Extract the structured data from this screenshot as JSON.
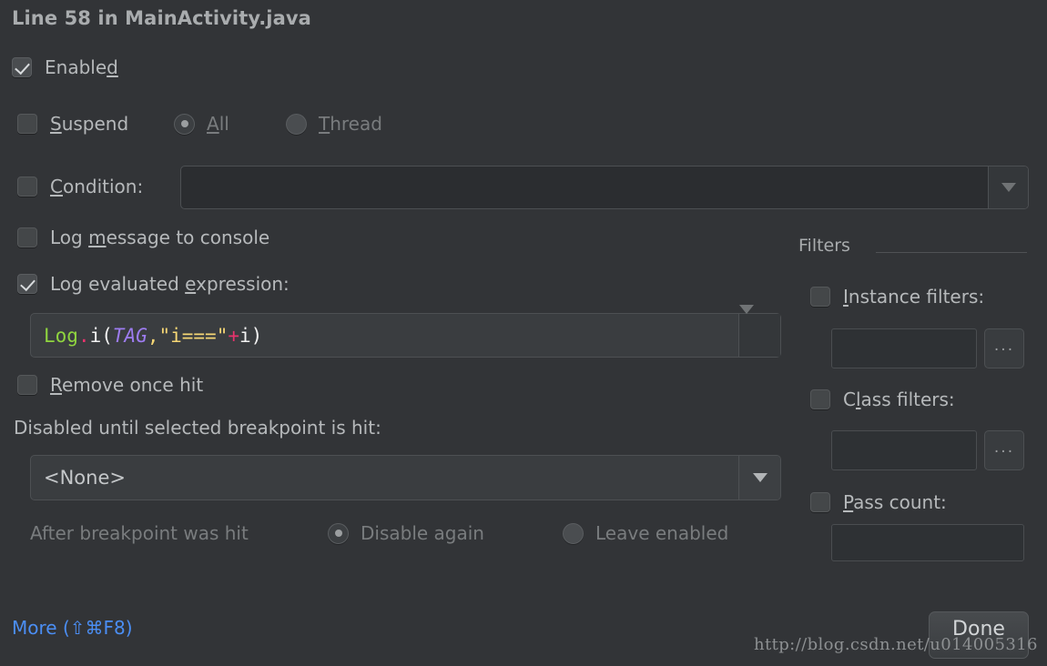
{
  "dialog": {
    "title": "Line 58 in MainActivity.java"
  },
  "enabled_row": {
    "label_pre": "Enable",
    "label_mnemonic": "d",
    "checked": true
  },
  "suspend_row": {
    "label_mnemonic": "S",
    "label_post": "uspend",
    "checked": false,
    "options": [
      {
        "label_mnemonic": "A",
        "label_post": "ll",
        "selected": true
      },
      {
        "label_mnemonic": "T",
        "label_post": "hread",
        "selected": false
      }
    ]
  },
  "condition_row": {
    "label_mnemonic": "C",
    "label_post": "ondition:",
    "checked": false,
    "value": "",
    "arrow_icon": "chevron-down-icon"
  },
  "log_message_row": {
    "label_pre": "Log ",
    "label_mnemonic": "m",
    "label_post": "essage to console",
    "checked": false
  },
  "log_expression_row": {
    "label_pre": "Log evaluated ",
    "label_mnemonic": "e",
    "label_post": "xpression:",
    "checked": true,
    "arrow_icon": "chevron-down-icon",
    "expression": {
      "full_text": "Log.i(TAG,\"i===\"+i)",
      "tokens": [
        {
          "text": "Log",
          "kind": "class"
        },
        {
          "text": ".",
          "kind": "dot"
        },
        {
          "text": "i(",
          "kind": "plain"
        },
        {
          "text": "TAG",
          "kind": "variable"
        },
        {
          "text": ",",
          "kind": "comma"
        },
        {
          "text": "\"i===\"",
          "kind": "string"
        },
        {
          "text": "+",
          "kind": "operator"
        },
        {
          "text": "i)",
          "kind": "plain"
        }
      ]
    }
  },
  "remove_once_hit_row": {
    "label_mnemonic": "R",
    "label_post": "emove once hit",
    "checked": false
  },
  "disabled_until": {
    "label": "Disabled until selected breakpoint is hit:",
    "value": "<None>",
    "arrow_icon": "chevron-down-icon",
    "after_hit_label": "After breakpoint was hit",
    "options": [
      {
        "label": "Disable again",
        "selected": true
      },
      {
        "label": "Leave enabled",
        "selected": false
      }
    ]
  },
  "filters": {
    "group_title": "Filters",
    "instance": {
      "label_mnemonic": "I",
      "label_post": "nstance filters:",
      "checked": false,
      "value": "",
      "browse_label": "..."
    },
    "class": {
      "label_pre": "C",
      "label_mnemonic": "l",
      "label_post": "ass filters:",
      "checked": false,
      "value": "",
      "browse_label": "..."
    },
    "pass_count": {
      "label_mnemonic": "P",
      "label_post": "ass count:",
      "checked": false,
      "value": ""
    }
  },
  "footer": {
    "more_label": "More (⇧⌘F8)",
    "done_label": "Done",
    "watermark": "http://blog.csdn.net/u014005316"
  },
  "colors": {
    "background": "#323437",
    "text": "#b6b9bb",
    "text_dim": "#797c7e",
    "link": "#4b8ef4",
    "code_class": "#8fd43f",
    "code_string": "#f5d675",
    "code_variable": "#9d7cf0",
    "code_operator": "#e8336d"
  }
}
